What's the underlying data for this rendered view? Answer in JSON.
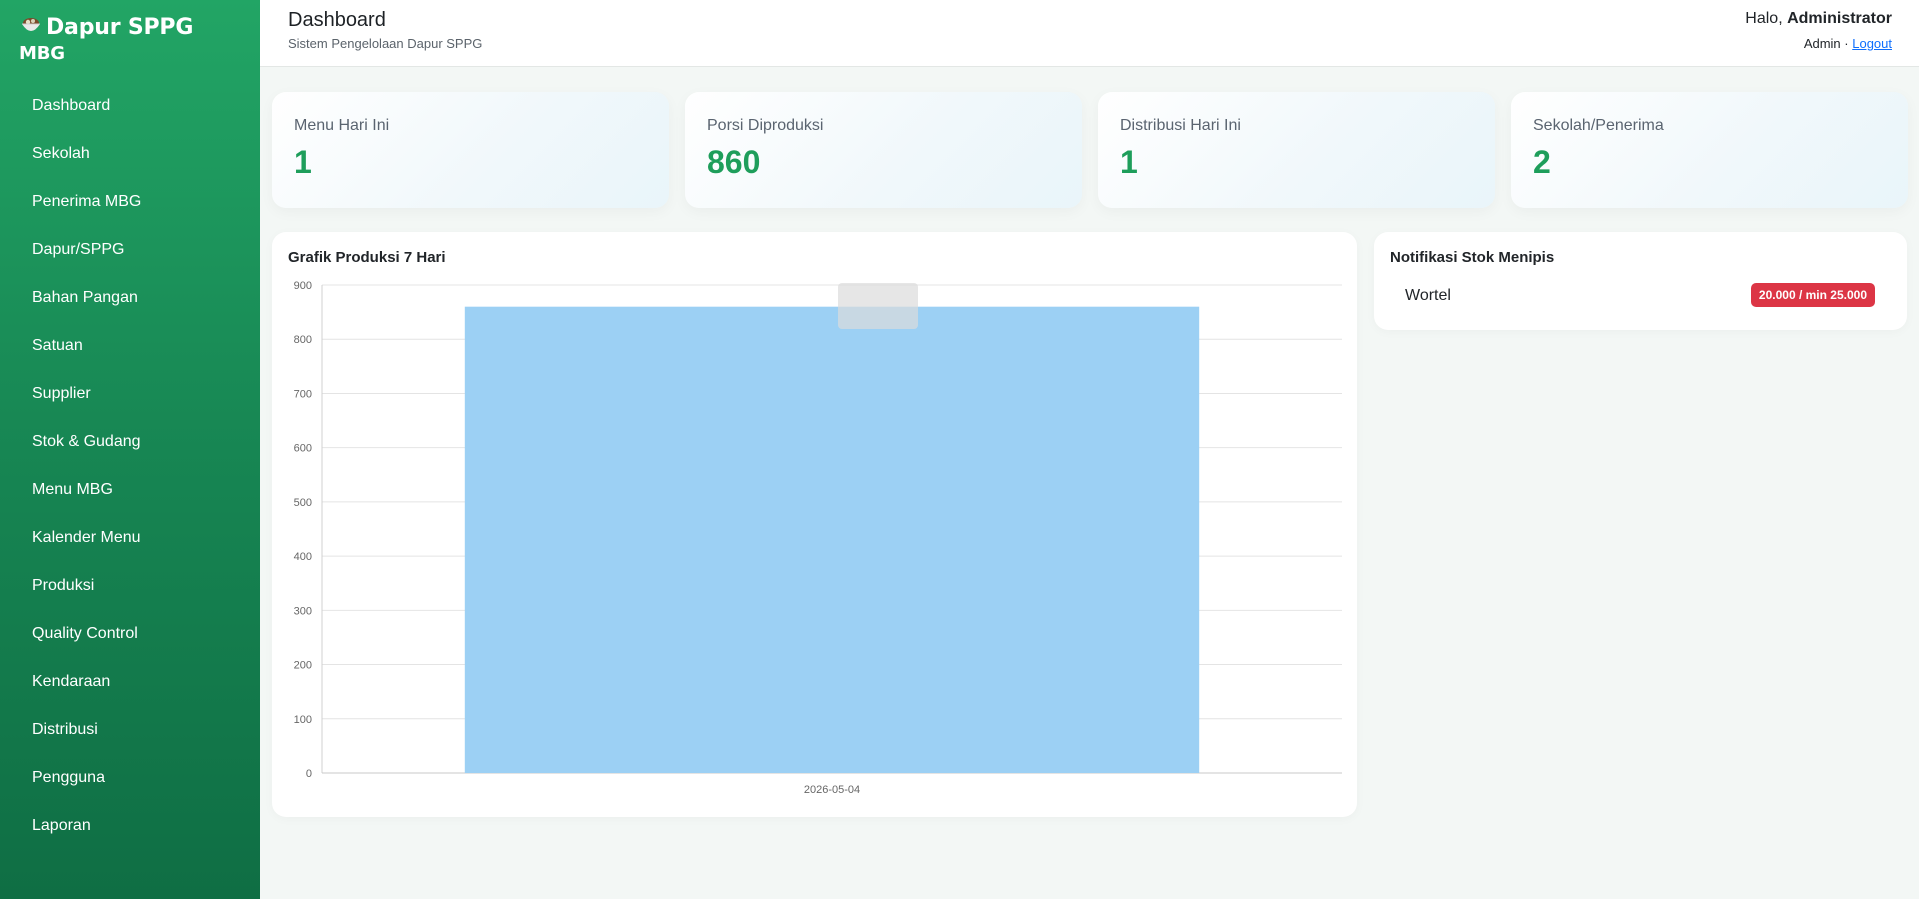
{
  "sidebar": {
    "brand_line1": "Dapur SPPG",
    "brand_line2": "MBG",
    "brand_icon": "bowl-icon",
    "items": [
      {
        "label": "Dashboard"
      },
      {
        "label": "Sekolah"
      },
      {
        "label": "Penerima MBG"
      },
      {
        "label": "Dapur/SPPG"
      },
      {
        "label": "Bahan Pangan"
      },
      {
        "label": "Satuan"
      },
      {
        "label": "Supplier"
      },
      {
        "label": "Stok & Gudang"
      },
      {
        "label": "Menu MBG"
      },
      {
        "label": "Kalender Menu"
      },
      {
        "label": "Produksi"
      },
      {
        "label": "Quality Control"
      },
      {
        "label": "Kendaraan"
      },
      {
        "label": "Distribusi"
      },
      {
        "label": "Pengguna"
      },
      {
        "label": "Laporan"
      }
    ]
  },
  "header": {
    "title": "Dashboard",
    "subtitle": "Sistem Pengelolaan Dapur SPPG",
    "greeting": "Halo,",
    "user_name": "Administrator",
    "role": "Admin ·",
    "logout_label": "Logout"
  },
  "stats": [
    {
      "label": "Menu Hari Ini",
      "value": "1"
    },
    {
      "label": "Porsi Diproduksi",
      "value": "860"
    },
    {
      "label": "Distribusi Hari Ini",
      "value": "1"
    },
    {
      "label": "Sekolah/Penerima",
      "value": "2"
    }
  ],
  "chart_panel": {
    "title": "Grafik Produksi 7 Hari"
  },
  "notifications": {
    "title": "Notifikasi Stok Menipis",
    "items": [
      {
        "name": "Wortel",
        "badge": "20.000 / min 25.000"
      }
    ]
  },
  "colors": {
    "sidebar": "#1e9e5b",
    "accent_value": "#1e9e5b",
    "bar": "#9cd0f4",
    "badge": "#dc3545",
    "link": "#0d6efd"
  },
  "chart_data": {
    "type": "bar",
    "title": "",
    "categories": [
      "2026-05-04"
    ],
    "values": [
      860
    ],
    "xlabel": "",
    "ylabel": "",
    "ylim": [
      0,
      900
    ],
    "yticks": [
      0,
      100,
      200,
      300,
      400,
      500,
      600,
      700,
      800,
      900
    ],
    "grid": true,
    "legend": "none"
  }
}
